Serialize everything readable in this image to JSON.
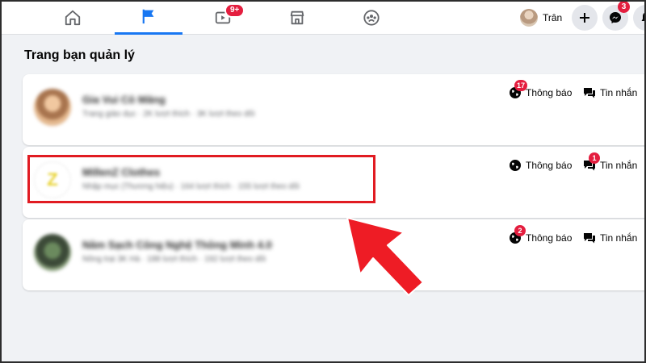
{
  "nav": {
    "tabs": [
      {
        "name": "home",
        "icon": "home-icon"
      },
      {
        "name": "pages",
        "icon": "flag-icon",
        "active": true
      },
      {
        "name": "watch",
        "icon": "video-icon",
        "badge": "9+"
      },
      {
        "name": "marketplace",
        "icon": "store-icon"
      },
      {
        "name": "groups",
        "icon": "groups-icon"
      }
    ],
    "watch_badge": "9+",
    "profile_name": "Trân",
    "messenger_badge": "3"
  },
  "section_title": "Trang bạn quản lý",
  "cards": [
    {
      "name": "Gia Vui Cô Măng",
      "meta": "Trang giáo dục · 2K lượt thích · 3K lượt theo dõi",
      "notif_label": "Thông báo",
      "notif_badge": "17",
      "msg_label": "Tin nhắn",
      "msg_badge": ""
    },
    {
      "name": "MillenZ Clothes",
      "meta": "Nhập mục (Thương hiệu) · 164 lượt thích · 155 lượt theo dõi",
      "avatar_text": "Z",
      "notif_label": "Thông báo",
      "notif_badge": "",
      "msg_label": "Tin nhắn",
      "msg_badge": "1"
    },
    {
      "name": "Nâm Sạch Công Nghệ Thông Minh 4.0",
      "meta": "Nông trại 3K Hà · 188 lượt thích · 192 lượt theo dõi",
      "notif_label": "Thông báo",
      "notif_badge": "2",
      "msg_label": "Tin nhắn",
      "msg_badge": ""
    }
  ],
  "colors": {
    "accent": "#1877f2",
    "badge": "#e41e3f",
    "annotation": "#e11b22",
    "background": "#f0f2f5"
  }
}
